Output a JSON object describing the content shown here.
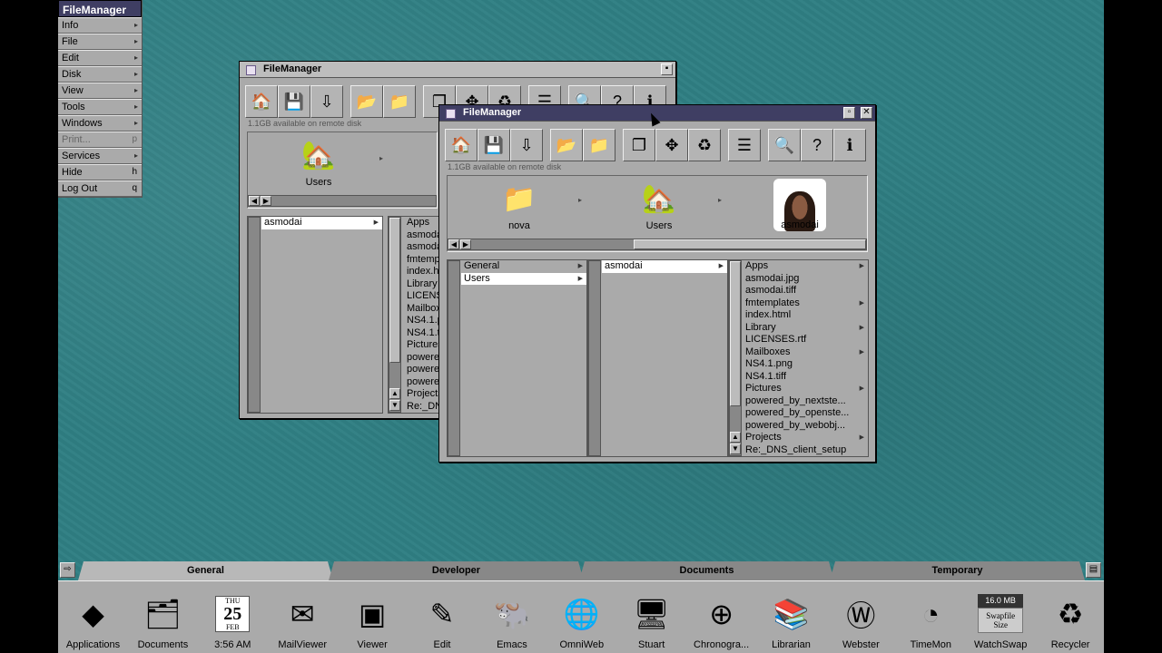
{
  "menu": {
    "title": "FileManager",
    "items": [
      {
        "label": "Info",
        "arrow": true
      },
      {
        "label": "File",
        "arrow": true
      },
      {
        "label": "Edit",
        "arrow": true
      },
      {
        "label": "Disk",
        "arrow": true
      },
      {
        "label": "View",
        "arrow": true
      },
      {
        "label": "Tools",
        "arrow": true
      },
      {
        "label": "Windows",
        "arrow": true
      },
      {
        "label": "Print...",
        "key": "p",
        "disabled": true
      },
      {
        "label": "Services",
        "arrow": true
      },
      {
        "label": "Hide",
        "key": "h"
      },
      {
        "label": "Log Out",
        "key": "q"
      }
    ]
  },
  "back_window": {
    "title": "FileManager",
    "free_space": "1.1GB available on remote disk",
    "shelf_label": "Users",
    "column1": [
      "asmodai"
    ],
    "column2": [
      "Apps",
      "asmoda",
      "asmoda",
      "fmtempl",
      "index.ht",
      "Library",
      "LICENS",
      "Mailbox",
      "NS4.1.p",
      "NS4.1.t",
      "Pictures",
      "powere",
      "powere",
      "powere",
      "Projects",
      "Re:_DN"
    ]
  },
  "front_window": {
    "title": "FileManager",
    "free_space": "1.1GB available on remote disk",
    "shelf": [
      {
        "label": "nova",
        "icon": "folder-icon"
      },
      {
        "label": "Users",
        "icon": "house-icon"
      },
      {
        "label": "asmodai",
        "icon": "user-photo"
      }
    ],
    "column1": [
      {
        "label": "General",
        "arrow": true,
        "selected": false
      },
      {
        "label": "Users",
        "arrow": true,
        "selected": true
      }
    ],
    "column2": [
      {
        "label": "asmodai",
        "arrow": true,
        "selected": true
      }
    ],
    "column3": [
      {
        "label": "Apps",
        "arrow": true
      },
      {
        "label": "asmodai.jpg"
      },
      {
        "label": "asmodai.tiff"
      },
      {
        "label": "fmtemplates",
        "arrow": true
      },
      {
        "label": "index.html"
      },
      {
        "label": "Library",
        "arrow": true
      },
      {
        "label": "LICENSES.rtf"
      },
      {
        "label": "Mailboxes",
        "arrow": true
      },
      {
        "label": "NS4.1.png"
      },
      {
        "label": "NS4.1.tiff"
      },
      {
        "label": "Pictures",
        "arrow": true
      },
      {
        "label": "powered_by_nextste..."
      },
      {
        "label": "powered_by_openste..."
      },
      {
        "label": "powered_by_webobj..."
      },
      {
        "label": "Projects",
        "arrow": true
      },
      {
        "label": "Re:_DNS_client_setup"
      }
    ]
  },
  "dock_tabs": [
    "General",
    "Developer",
    "Documents",
    "Temporary"
  ],
  "dock_items": [
    {
      "label": "Applications",
      "icon": "next-cube-icon"
    },
    {
      "label": "Documents",
      "icon": "documents-icon"
    },
    {
      "label": "3:56 AM",
      "icon": "calendar-icon",
      "date": {
        "dow": "THU",
        "day": "25",
        "month": "FEB"
      }
    },
    {
      "label": "MailViewer",
      "icon": "mail-icon"
    },
    {
      "label": "Viewer",
      "icon": "viewer-icon"
    },
    {
      "label": "Edit",
      "icon": "edit-icon"
    },
    {
      "label": "Emacs",
      "icon": "emacs-gnu-icon"
    },
    {
      "label": "OmniWeb",
      "icon": "omniweb-icon"
    },
    {
      "label": "Stuart",
      "icon": "terminal-icon"
    },
    {
      "label": "Chronogra...",
      "icon": "chronograph-icon"
    },
    {
      "label": "Librarian",
      "icon": "books-icon"
    },
    {
      "label": "Webster",
      "icon": "webster-icon"
    },
    {
      "label": "TimeMon",
      "icon": "timemon-icon"
    },
    {
      "label": "WatchSwap",
      "icon": "swapfile-icon",
      "lcd": "16.0 MB",
      "tile": "Swapfile Size"
    },
    {
      "label": "Recycler",
      "icon": "recycler-icon"
    }
  ],
  "colors": {
    "desktop": "#2f7f83",
    "titlebar_active": "#3f3e63",
    "chrome": "#aaaaaa"
  }
}
